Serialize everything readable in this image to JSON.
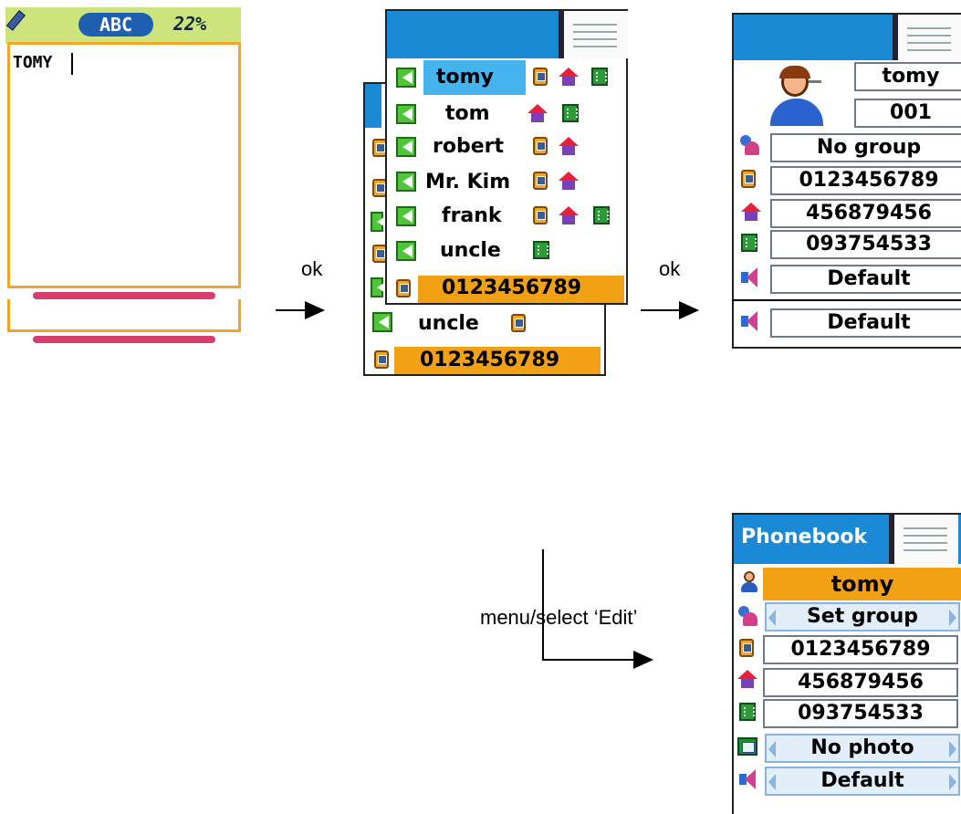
{
  "screen1": {
    "mode": "ABC",
    "battery": "22%",
    "input_text": "TOMY"
  },
  "screen2": {
    "contacts": [
      {
        "name": "tomy"
      },
      {
        "name": "tom"
      },
      {
        "name": "robert"
      },
      {
        "name": "Mr. Kim"
      },
      {
        "name": "frank"
      },
      {
        "name": "uncle"
      }
    ],
    "selected_number": "0123456789",
    "back_contact": "uncle",
    "back_number": "0123456789"
  },
  "arrow1": {
    "label": "ok"
  },
  "arrow2": {
    "label": "ok"
  },
  "arrow3": {
    "label": "menu/select ‘Edit’"
  },
  "screen3": {
    "name": "tomy",
    "id": "001",
    "group": "No group",
    "mobile": "0123456789",
    "home": "456879456",
    "office": "093754533",
    "ringtone": "Default",
    "ringtone_back": "Default"
  },
  "screen4": {
    "title": "Phonebook",
    "name": "tomy",
    "group": "Set group",
    "mobile": "0123456789",
    "home": "456879456",
    "office": "093754533",
    "photo": "No photo",
    "ringtone": "Default"
  }
}
